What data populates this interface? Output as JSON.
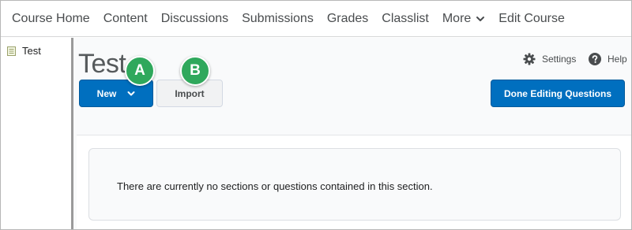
{
  "nav": {
    "items": [
      {
        "label": "Course Home"
      },
      {
        "label": "Content"
      },
      {
        "label": "Discussions"
      },
      {
        "label": "Submissions"
      },
      {
        "label": "Grades"
      },
      {
        "label": "Classlist"
      },
      {
        "label": "More"
      },
      {
        "label": "Edit Course"
      }
    ]
  },
  "sidebar": {
    "items": [
      {
        "label": "Test",
        "icon": "document-icon"
      }
    ]
  },
  "main": {
    "title": "Test",
    "settings_label": "Settings",
    "help_label": "Help",
    "new_label": "New",
    "import_label": "Import",
    "done_label": "Done Editing Questions",
    "empty_message": "There are currently no sections or questions contained in this section."
  },
  "callouts": {
    "a": "A",
    "b": "B"
  },
  "colors": {
    "primary": "#006fbf",
    "callout": "#2fa85c"
  }
}
